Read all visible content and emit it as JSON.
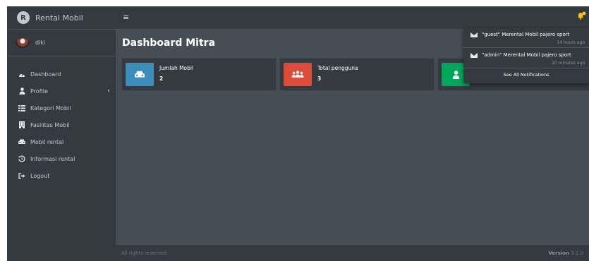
{
  "brand": {
    "logo_letter": "R",
    "name": "Rental Mobil"
  },
  "user": {
    "name": "diki"
  },
  "sidebar": {
    "items": [
      {
        "label": "Dashboard",
        "icon": "tachometer-icon"
      },
      {
        "label": "Profile",
        "icon": "user-icon",
        "chevron": "‹"
      },
      {
        "label": "Kategori Mobil",
        "icon": "list-icon"
      },
      {
        "label": "Fasilitas Mobil",
        "icon": "building-icon"
      },
      {
        "label": "Mobil rental",
        "icon": "car-icon"
      },
      {
        "label": "Informasi rental",
        "icon": "history-icon"
      },
      {
        "label": "Logout",
        "icon": "sign-out-icon"
      }
    ]
  },
  "topbar": {
    "menu_icon": "≡",
    "bell_color": "#ffc107"
  },
  "page": {
    "title": "Dashboard Mitra"
  },
  "stats": [
    {
      "label": "Jumlah Mobil",
      "value": "2",
      "color": "#3c8dbc",
      "icon": "car-icon"
    },
    {
      "label": "Total pengguna",
      "value": "3",
      "color": "#dd4b39",
      "icon": "users-icon"
    },
    {
      "label": "",
      "value": "",
      "color": "#00a65a",
      "icon": "user-icon"
    }
  ],
  "notifications": {
    "items": [
      {
        "text": "\"guest\" Merental Mobil pajero sport",
        "time": "14 hours ago"
      },
      {
        "text": "\"admin\" Merental Mobil pajero sport",
        "time": "10 minutes ago"
      }
    ],
    "see_all": "See All Notifications"
  },
  "footer": {
    "left": "All rights reserved.",
    "version_label": "Version",
    "version_number": "3.1.0"
  },
  "colors": {
    "sidebar": "#343a40",
    "content": "#454d55",
    "text": "#c2c7d0"
  }
}
